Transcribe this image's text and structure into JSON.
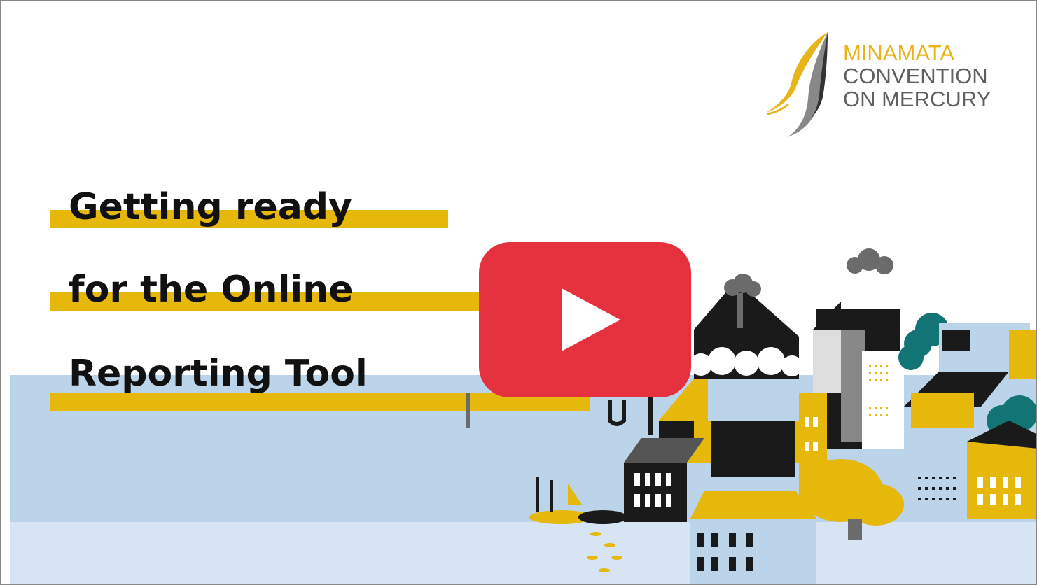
{
  "logo": {
    "line1": "MINAMATA",
    "line2": "CONVENTION",
    "line3": "ON MERCURY",
    "accent_color": "#e7b51b",
    "text_color": "#5f5f5f"
  },
  "title": {
    "line1": "Getting ready",
    "line2": "for the Online",
    "line3": "Reporting Tool",
    "highlight_color": "#e5b80b"
  },
  "play_button": {
    "icon": "play-icon",
    "color": "#e5303e"
  },
  "colors": {
    "water_light": "#d6e4f3",
    "water_dark": "#bcd4ea",
    "black": "#1a1a1a",
    "yellow": "#e5b80b",
    "teal": "#127475",
    "gray": "#6b6b6b"
  }
}
